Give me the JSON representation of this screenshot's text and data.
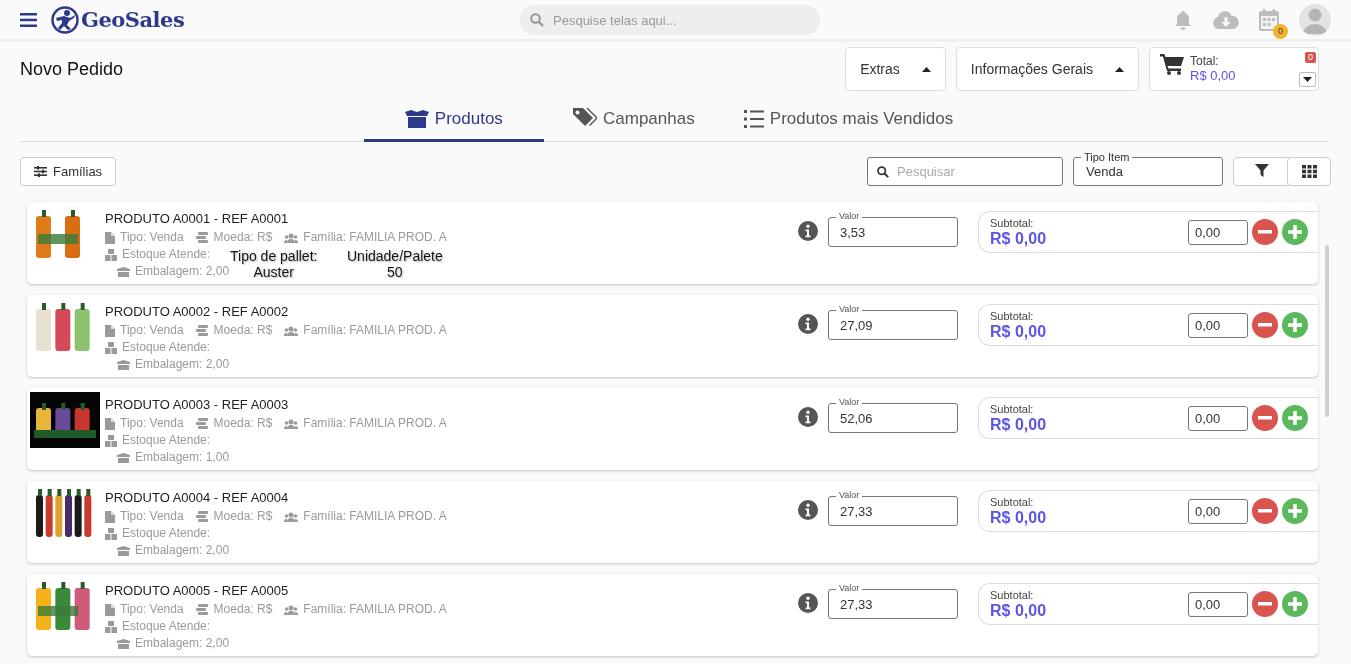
{
  "header": {
    "logo": "GeoSales",
    "search": {
      "placeholder": "Pesquise telas aqui..."
    },
    "calendar_badge": "0"
  },
  "page": {
    "title": "Novo Pedido",
    "dropdowns": [
      "Extras",
      "Informações Gerais"
    ],
    "cart": {
      "label": "Total:",
      "value": "R$ 0,00",
      "badge": "0"
    }
  },
  "tabs": [
    {
      "label": "Produtos",
      "kind": "boxes",
      "selected": true
    },
    {
      "label": "Campanhas",
      "kind": "tags",
      "selected": false
    },
    {
      "label": "Produtos mais Vendidos",
      "kind": "list",
      "selected": false
    }
  ],
  "toolbar": {
    "families_button": "Famílias",
    "search": {
      "placeholder": "Pesquisar"
    },
    "item_type": {
      "label": "Tipo Item",
      "value": "Venda"
    }
  },
  "products": [
    {
      "name": "PRODUTO A0001 - REF A0001",
      "tipo": "Tipo: Venda",
      "moeda": "Moeda: R$",
      "familia": "Família: FAMILIA PROD. A",
      "estoque": "Estoque Atende:",
      "embalagem": "Embalagem: 2,00",
      "valor_label": "Valor",
      "valor": "3,53",
      "subtotal_label": "Subtotal:",
      "subtotal": "R$ 0,00",
      "quantity": "0,00",
      "tooltips": [
        {
          "label": "Tipo de pallet:",
          "value": "Auster"
        },
        {
          "label": "Unidade/Palete",
          "value": "50"
        }
      ]
    },
    {
      "name": "PRODUTO A0002 - REF A0002",
      "tipo": "Tipo: Venda",
      "moeda": "Moeda: R$",
      "familia": "Família: FAMILIA PROD. A",
      "estoque": "Estoque Atende:",
      "embalagem": "Embalagem: 2,00",
      "valor_label": "Valor",
      "valor": "27,09",
      "subtotal_label": "Subtotal:",
      "subtotal": "R$ 0,00",
      "quantity": "0,00"
    },
    {
      "name": "PRODUTO A0003 - REF A0003",
      "tipo": "Tipo: Venda",
      "moeda": "Moeda: R$",
      "familia": "Família: FAMILIA PROD. A",
      "estoque": "Estoque Atende:",
      "embalagem": "Embalagem: 1,00",
      "valor_label": "Valor",
      "valor": "52,06",
      "subtotal_label": "Subtotal:",
      "subtotal": "R$ 0,00",
      "quantity": "0,00"
    },
    {
      "name": "PRODUTO A0004 - REF A0004",
      "tipo": "Tipo: Venda",
      "moeda": "Moeda: R$",
      "familia": "Família: FAMILIA PROD. A",
      "estoque": "Estoque Atende:",
      "embalagem": "Embalagem: 2,00",
      "valor_label": "Valor",
      "valor": "27,33",
      "subtotal_label": "Subtotal:",
      "subtotal": "R$ 0,00",
      "quantity": "0,00"
    },
    {
      "name": "PRODUTO A0005 - REF A0005",
      "tipo": "Tipo: Venda",
      "moeda": "Moeda: R$",
      "familia": "Família: FAMILIA PROD. A",
      "estoque": "Estoque Atende:",
      "embalagem": "Embalagem: 2,00",
      "valor_label": "Valor",
      "valor": "27,33",
      "subtotal_label": "Subtotal:",
      "subtotal": "R$ 0,00",
      "quantity": "0,00"
    }
  ]
}
